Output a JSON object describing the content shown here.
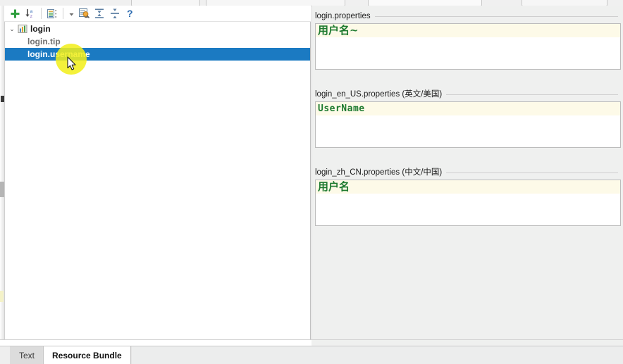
{
  "toolbar": {
    "buttons": [
      {
        "name": "add-entry-button",
        "icon": "plus-icon",
        "label": "+"
      },
      {
        "name": "sort-az-button",
        "icon": "sort-az-icon",
        "label": "A-Z"
      },
      {
        "name": "group-by-button",
        "icon": "list-tree-icon",
        "label": "Group"
      },
      {
        "name": "filter-dropdown-button",
        "icon": "chevron-down-icon",
        "label": ""
      },
      {
        "name": "edit-properties-button",
        "icon": "properties-wrench-icon",
        "label": ""
      },
      {
        "name": "collapse-all-button",
        "icon": "collapse-all-icon",
        "label": ""
      },
      {
        "name": "expand-all-button",
        "icon": "expand-all-icon",
        "label": ""
      },
      {
        "name": "help-button",
        "icon": "question-mark-icon",
        "label": "?"
      }
    ]
  },
  "tree": {
    "root": {
      "label": "login",
      "icon": "resource-bundle-icon",
      "expanded": true,
      "twisty": "⌄"
    },
    "children": [
      {
        "label": "login.tip",
        "selected": false
      },
      {
        "label": "login.username",
        "selected": true
      }
    ]
  },
  "editors": [
    {
      "locale_file": "login.properties",
      "value": "用户名~",
      "value_style": "cn"
    },
    {
      "locale_file": "login_en_US.properties (英文/美国)",
      "value": "UserName",
      "value_style": "en"
    },
    {
      "locale_file": "login_zh_CN.properties (中文/中国)",
      "value": "用户名",
      "value_style": "cn"
    }
  ],
  "tabs": [
    {
      "label": "Text",
      "active": false
    },
    {
      "label": "Resource Bundle",
      "active": true
    }
  ],
  "colors": {
    "selection_blue": "#1b7ac2",
    "value_green": "#1d7a2f",
    "highlight_line": "#fdfae8",
    "panel_bg": "#eff0ef",
    "cursor_halo": "#f2ef1a"
  }
}
